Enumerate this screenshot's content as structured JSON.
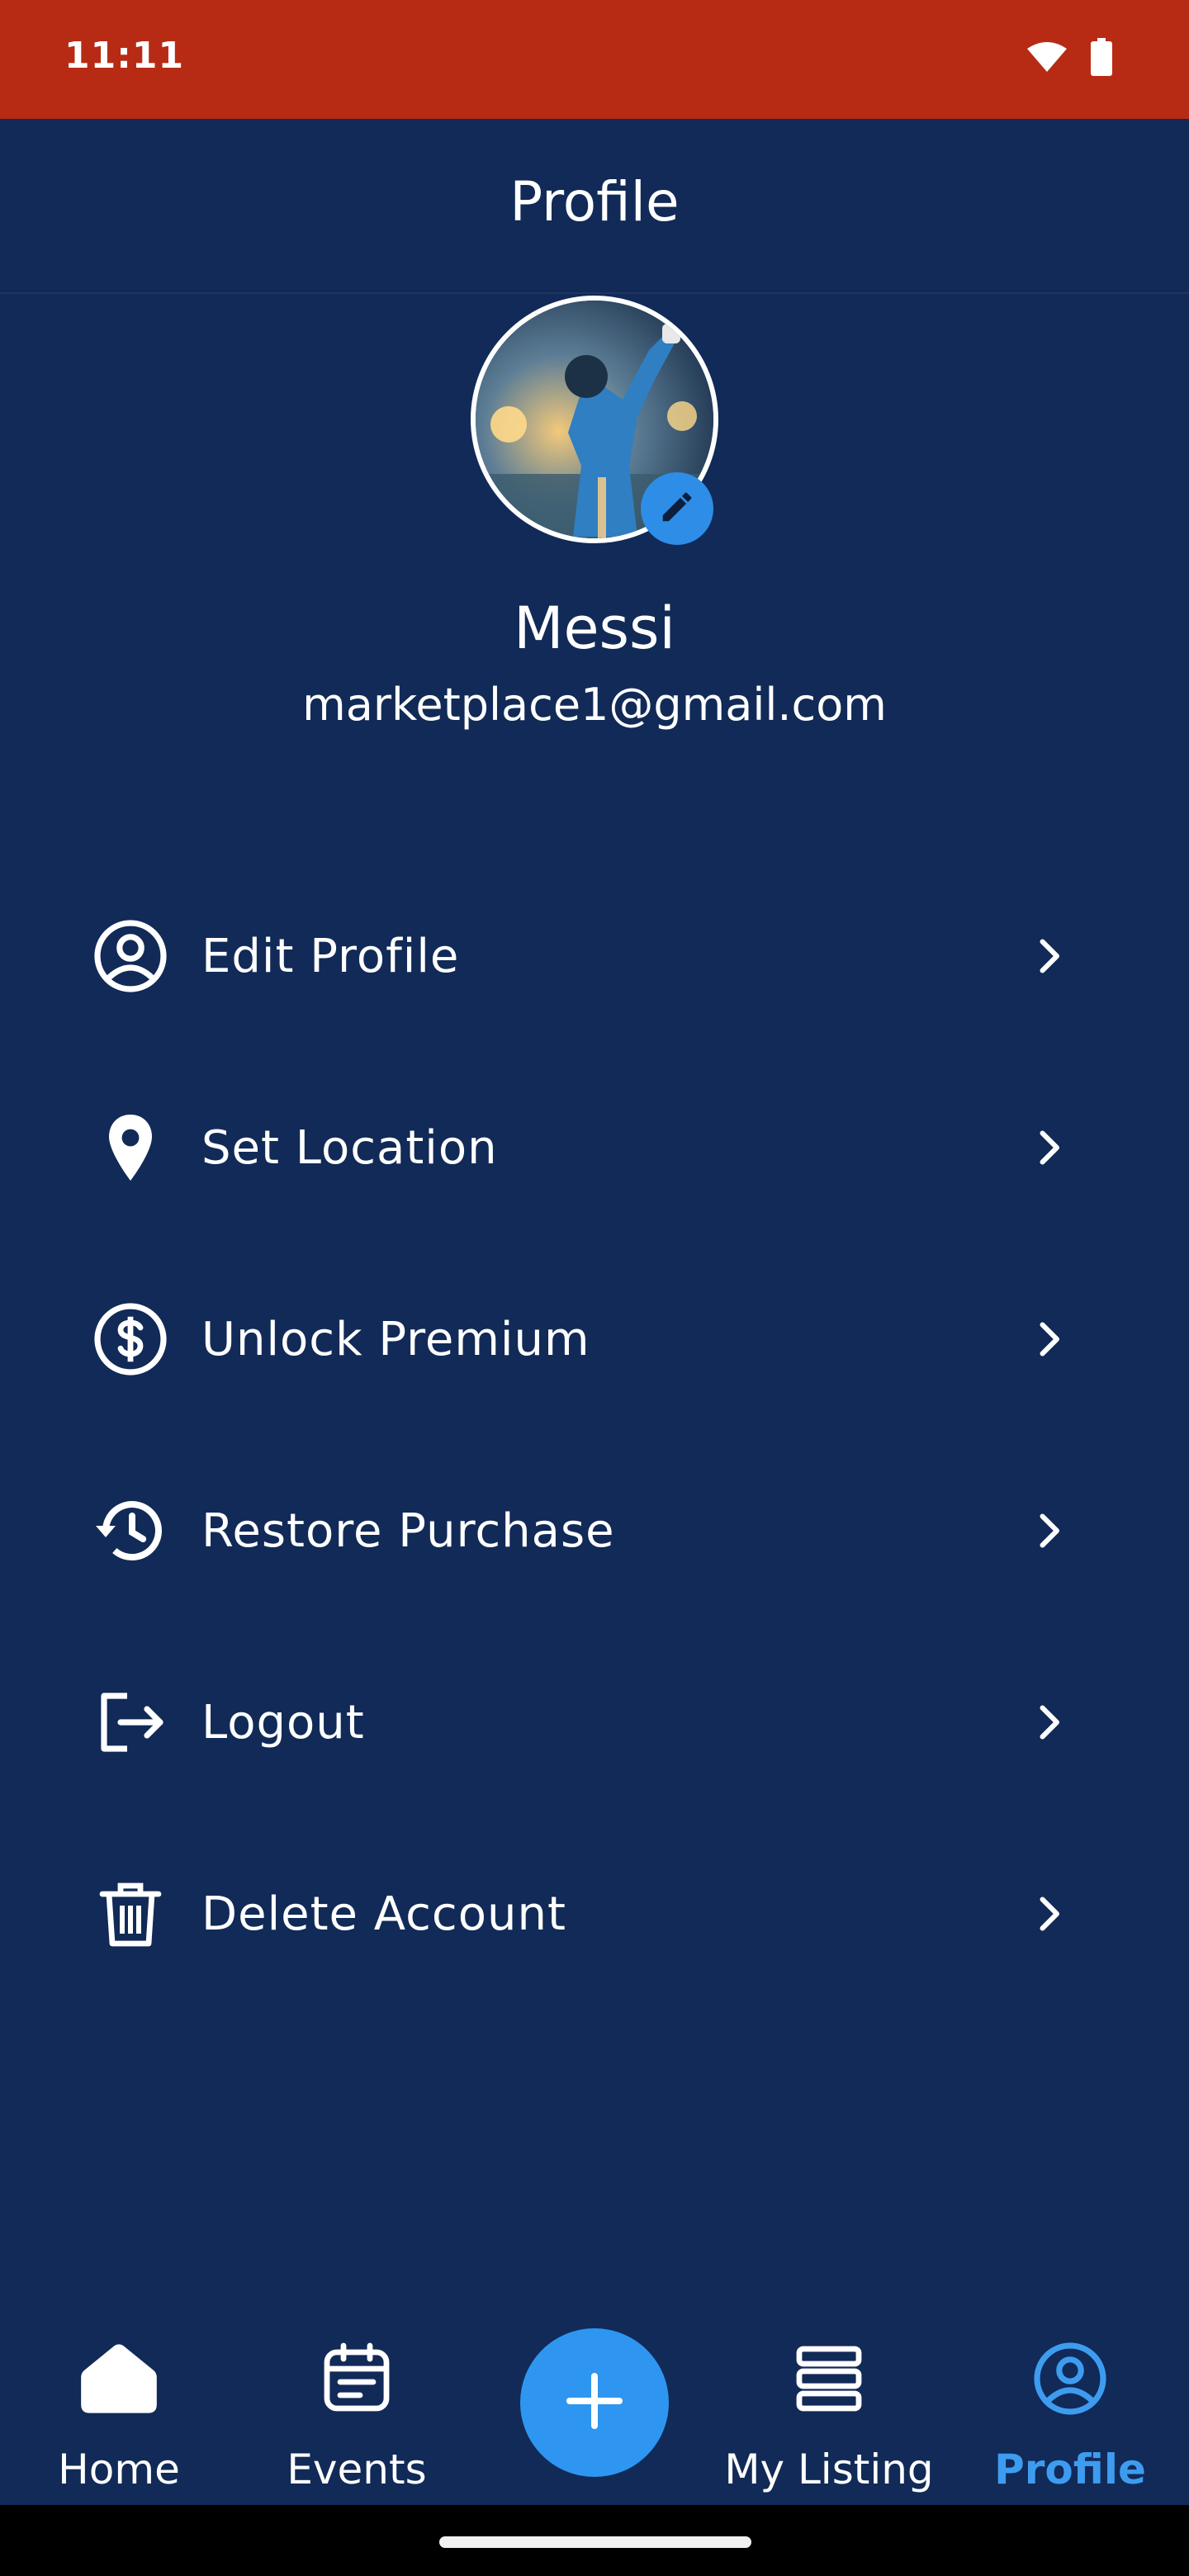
{
  "status_bar": {
    "time": "11:11",
    "background": "#b72b14"
  },
  "header": {
    "title": "Profile"
  },
  "profile": {
    "name": "Messi",
    "email": "marketplace1@gmail.com",
    "avatar_icon": "avatar-photo",
    "edit_icon": "pencil-icon"
  },
  "menu": [
    {
      "label": "Edit Profile",
      "icon": "account-circle-icon"
    },
    {
      "label": "Set Location",
      "icon": "location-pin-icon"
    },
    {
      "label": "Unlock Premium",
      "icon": "dollar-circle-icon"
    },
    {
      "label": "Restore Purchase",
      "icon": "history-icon"
    },
    {
      "label": "Logout",
      "icon": "logout-icon"
    },
    {
      "label": "Delete Account",
      "icon": "trash-icon"
    }
  ],
  "bottom_nav": {
    "items": [
      {
        "label": "Home",
        "icon": "home-icon"
      },
      {
        "label": "Events",
        "icon": "calendar-icon"
      },
      {
        "label": "My Listing",
        "icon": "list-icon"
      },
      {
        "label": "Profile",
        "icon": "profile-icon",
        "active": true
      }
    ],
    "fab_icon": "plus-icon"
  },
  "colors": {
    "background": "#112a57",
    "accent": "#2e96f0",
    "active_tab": "#3e9cf0"
  }
}
